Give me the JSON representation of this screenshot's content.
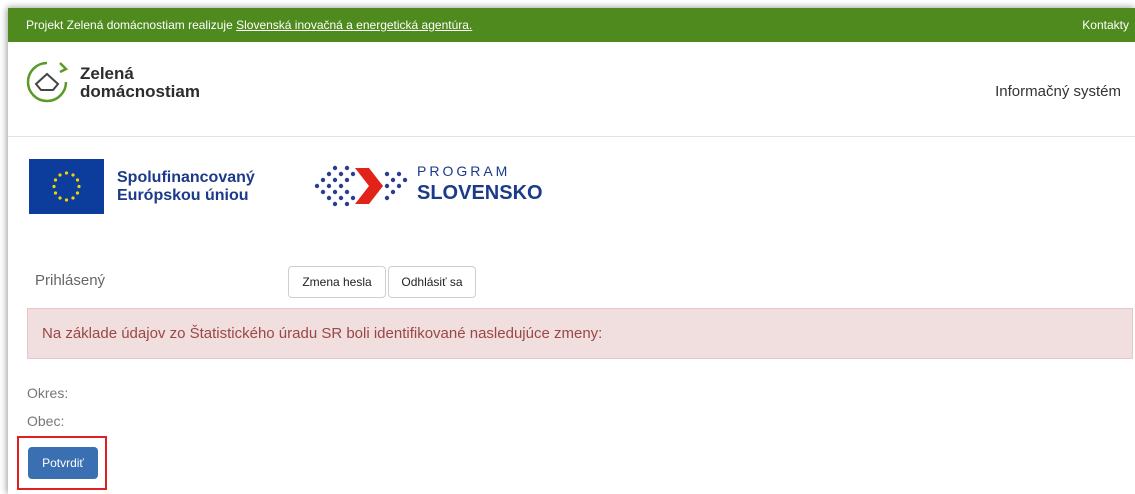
{
  "topbar": {
    "prefix": "Projekt Zelená domácnostiam realizuje ",
    "agency_link": "Slovenská inovačná a energetická agentúra.",
    "contacts": "Kontakty"
  },
  "header": {
    "logo_line1": "Zelená",
    "logo_line2": "domácnostiam",
    "system_name": "Informačný systém"
  },
  "eu": {
    "line1": "Spolufinancovaný",
    "line2": "Európskou úniou"
  },
  "program": {
    "line1": "PROGRAM",
    "line2": "SLOVENSKO"
  },
  "user": {
    "logged_in_label": "Prihlásený",
    "change_password": "Zmena hesla",
    "logout": "Odhlásiť sa"
  },
  "alert": {
    "message": "Na základe údajov zo Štatistického úradu SR boli identifikované nasledujúce zmeny:"
  },
  "fields": {
    "okres": "Okres:",
    "obec": "Obec:"
  },
  "actions": {
    "confirm": "Potvrdiť"
  },
  "colors": {
    "topbar": "#4e8a1e",
    "primary_button": "#3a6fb2",
    "alert_bg": "#f1dede",
    "highlight": "#e02020"
  }
}
